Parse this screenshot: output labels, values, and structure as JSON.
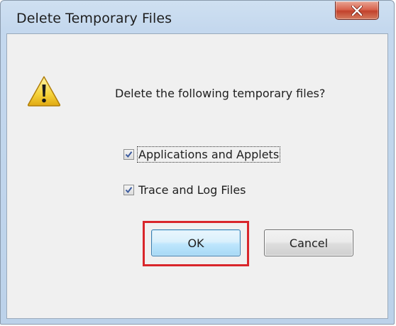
{
  "window": {
    "title": "Delete Temporary Files"
  },
  "dialog": {
    "message": "Delete the following temporary files?",
    "icon": "warning-icon",
    "options": [
      {
        "label": "Applications and Applets",
        "checked": true,
        "focused": true
      },
      {
        "label": "Trace and Log Files",
        "checked": true,
        "focused": false
      }
    ]
  },
  "buttons": {
    "ok_label": "OK",
    "cancel_label": "Cancel"
  },
  "colors": {
    "highlight": "#d9262b",
    "close_button": "#c2422c",
    "default_button_border": "#3c7fb1"
  }
}
